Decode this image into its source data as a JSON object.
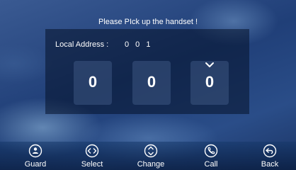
{
  "prompt": "Please PIck up the handset !",
  "address": {
    "label": "Local Address :",
    "value": "0 0 1"
  },
  "digits": [
    "0",
    "0",
    "0"
  ],
  "toolbar": {
    "buttons": [
      {
        "label": "Guard",
        "icon": "guard-icon"
      },
      {
        "label": "Select",
        "icon": "select-icon"
      },
      {
        "label": "Change",
        "icon": "change-icon"
      },
      {
        "label": "Call",
        "icon": "phone-icon"
      },
      {
        "label": "Back",
        "icon": "back-icon"
      }
    ]
  },
  "colors": {
    "text": "#ffffff",
    "background": "#2a4a86",
    "panel": "#05122a"
  }
}
